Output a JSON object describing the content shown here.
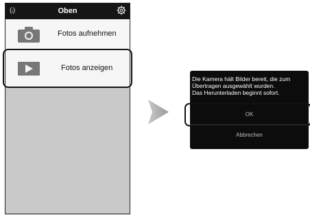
{
  "phone": {
    "wifi_icon": "(ᵢ)",
    "title": "Oben",
    "gear_icon": "gear-icon",
    "items": [
      {
        "label": "Fotos aufnehmen",
        "icon": "camera-icon"
      },
      {
        "label": "Fotos anzeigen",
        "icon": "play-icon"
      }
    ]
  },
  "dialog": {
    "message_line1": "Die Kamera hält Bilder bereit, die zum",
    "message_line2": "Übertragen ausgewählt wurden.",
    "message_line3": "Das Herunterladen beginnt sofort.",
    "ok_label": "OK",
    "cancel_label": "Abbrechen"
  },
  "colors": {
    "topbar": "#151515",
    "phone_bg": "#c9c9c9",
    "dialog_bg": "#0c0c0c"
  }
}
